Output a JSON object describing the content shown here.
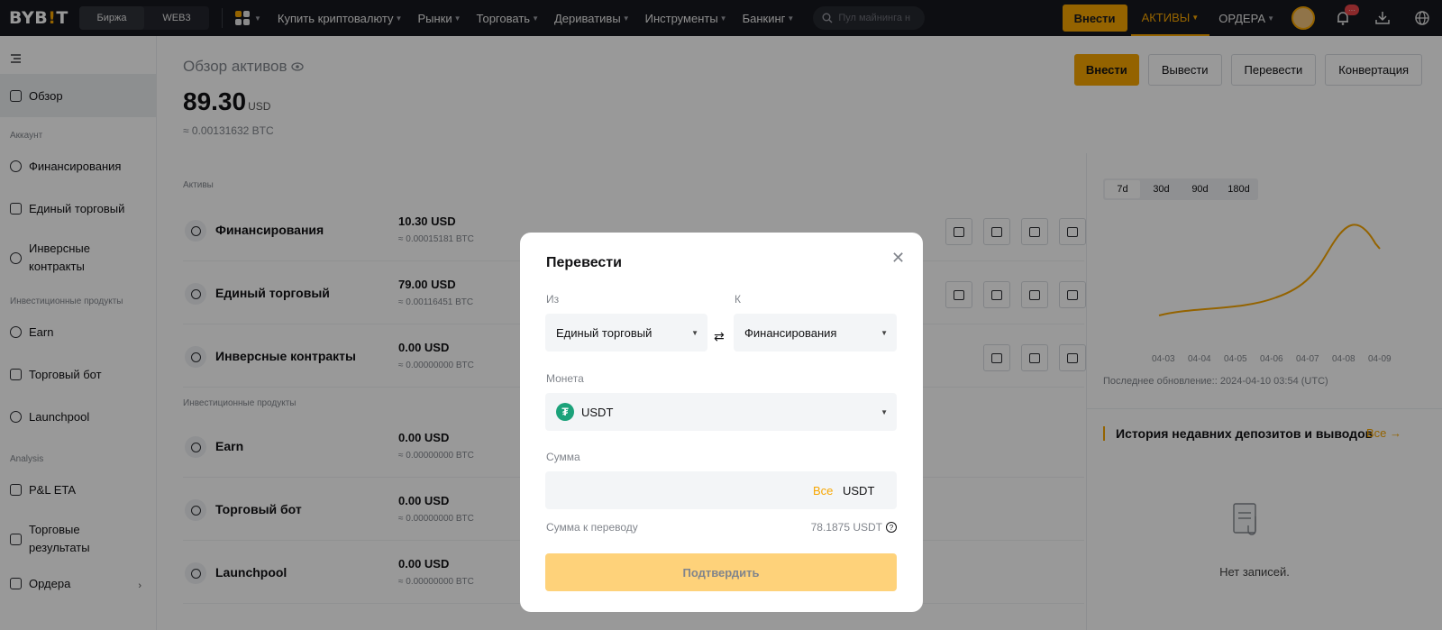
{
  "topnav": {
    "logo_main": "BYB",
    "logo_dot": "!",
    "logo_end": "T",
    "segments": [
      "Биржа",
      "WEB3"
    ],
    "links": [
      "Купить криптовалюту",
      "Рынки",
      "Торговать",
      "Деривативы",
      "Инструменты",
      "Банкинг"
    ],
    "search_placeholder": "Пул майнинга н",
    "deposit_label": "Внести",
    "assets_label": "АКТИВЫ",
    "orders_label": "ОРДЕРА",
    "notifications_badge": "···"
  },
  "sidebar": {
    "overview": "Обзор",
    "group_account": "Аккаунт",
    "funding": "Финансирования",
    "unified": "Единый торговый",
    "inverse": "Инверсные контракты",
    "group_invest": "Инвестиционные продукты",
    "earn": "Earn",
    "bot": "Торговый бот",
    "launchpool": "Launchpool",
    "group_analysis": "Analysis",
    "pnl": "P&L ETA",
    "results": "Торговые результаты",
    "orders": "Ордера"
  },
  "main": {
    "title": "Обзор активов",
    "total": "89.30",
    "total_unit": "USD",
    "total_btc": "≈ 0.00131632 BTC",
    "actions": [
      "Внести",
      "Вывести",
      "Перевести",
      "Конвертация"
    ],
    "section_assets": "Активы",
    "section_invest": "Инвестиционные продукты",
    "rows": [
      {
        "name": "Финансирования",
        "usd": "10.30 USD",
        "btc": "≈ 0.00015181 BTC"
      },
      {
        "name": "Единый торговый",
        "usd": "79.00 USD",
        "btc": "≈ 0.00116451 BTC"
      },
      {
        "name": "Инверсные контракты",
        "usd": "0.00 USD",
        "btc": "≈ 0.00000000 BTC"
      },
      {
        "name": "Earn",
        "usd": "0.00 USD",
        "btc": "≈ 0.00000000 BTC"
      },
      {
        "name": "Торговый бот",
        "usd": "0.00 USD",
        "btc": "≈ 0.00000000 BTC"
      },
      {
        "name": "Launchpool",
        "usd": "0.00 USD",
        "btc": "≈ 0.00000000 BTC"
      }
    ]
  },
  "right_panel": {
    "periods": [
      "7d",
      "30d",
      "90d",
      "180d"
    ],
    "x_labels": [
      "04-03",
      "04-04",
      "04-05",
      "04-06",
      "04-07",
      "04-08",
      "04-09"
    ],
    "last_update": "Последнее обновление:: 2024-04-10 03:54 (UTC)",
    "history_title": "История недавних депозитов и выводов",
    "history_all": "Все",
    "empty": "Нет записей."
  },
  "modal": {
    "title": "Перевести",
    "from_label": "Из",
    "to_label": "К",
    "from_value": "Единый торговый",
    "to_value": "Финансирования",
    "coin_label": "Монета",
    "coin_value": "USDT",
    "coin_symbol": "₮",
    "amount_label": "Сумма",
    "amount_all": "Все",
    "amount_unit": "USDT",
    "transferable_label": "Сумма к переводу",
    "transferable_value": "78.1875 USDT",
    "confirm_label": "Подтвердить"
  },
  "colors": {
    "accent": "#f7a600",
    "topbar_bg": "#17181e",
    "usdt": "#1ba27a",
    "confirm_disabled": "#fed27a"
  }
}
